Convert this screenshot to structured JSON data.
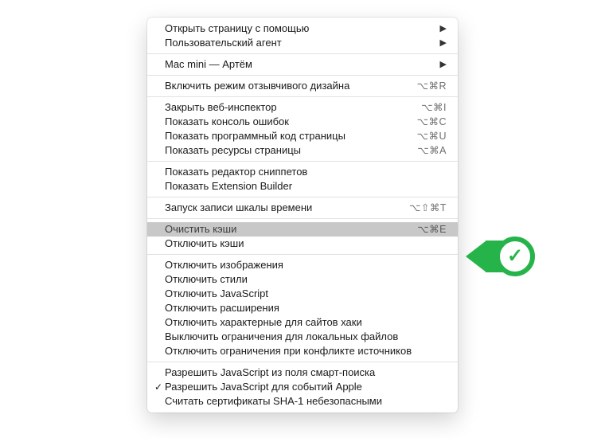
{
  "callout": {
    "color": "#26b44a"
  },
  "menu": {
    "sections": [
      [
        {
          "id": "open-with",
          "label": "Открыть страницу с помощью",
          "submenu": true
        },
        {
          "id": "user-agent",
          "label": "Пользовательский агент",
          "submenu": true
        }
      ],
      [
        {
          "id": "mac-mini",
          "label": "Mac mini — Артём",
          "submenu": true
        }
      ],
      [
        {
          "id": "responsive",
          "label": "Включить режим отзывчивого дизайна",
          "shortcut": "⌥⌘R"
        }
      ],
      [
        {
          "id": "close-inspector",
          "label": "Закрыть веб-инспектор",
          "shortcut": "⌥⌘I"
        },
        {
          "id": "error-console",
          "label": "Показать консоль ошибок",
          "shortcut": "⌥⌘C"
        },
        {
          "id": "page-source",
          "label": "Показать программный код страницы",
          "shortcut": "⌥⌘U"
        },
        {
          "id": "page-resources",
          "label": "Показать ресурсы страницы",
          "shortcut": "⌥⌘A"
        }
      ],
      [
        {
          "id": "snippet-editor",
          "label": "Показать редактор сниппетов"
        },
        {
          "id": "ext-builder",
          "label": "Показать Extension Builder"
        }
      ],
      [
        {
          "id": "timeline-rec",
          "label": "Запуск записи шкалы времени",
          "shortcut": "⌥⇧⌘T"
        }
      ],
      [
        {
          "id": "clear-caches",
          "label": "Очистить кэши",
          "shortcut": "⌥⌘E",
          "highlight": true
        },
        {
          "id": "disable-caches",
          "label": "Отключить кэши"
        }
      ],
      [
        {
          "id": "disable-images",
          "label": "Отключить изображения"
        },
        {
          "id": "disable-styles",
          "label": "Отключить стили"
        },
        {
          "id": "disable-js",
          "label": "Отключить JavaScript"
        },
        {
          "id": "disable-ext",
          "label": "Отключить расширения"
        },
        {
          "id": "disable-hacks",
          "label": "Отключить характерные для сайтов хаки"
        },
        {
          "id": "disable-local",
          "label": "Выключить ограничения для локальных файлов"
        },
        {
          "id": "disable-cors",
          "label": "Отключить ограничения при конфликте источников"
        }
      ],
      [
        {
          "id": "smart-js",
          "label": "Разрешить JavaScript из поля смарт-поиска"
        },
        {
          "id": "apple-events-js",
          "label": "Разрешить JavaScript для событий Apple",
          "checked": true
        },
        {
          "id": "sha1-unsafe",
          "label": "Считать сертификаты SHA-1 небезопасными"
        }
      ]
    ]
  }
}
